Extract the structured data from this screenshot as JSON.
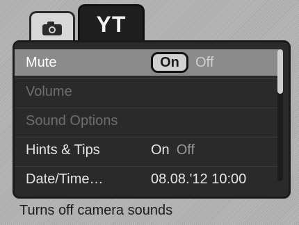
{
  "tabs": [
    {
      "icon": "camera-icon"
    },
    {
      "label": "YT"
    }
  ],
  "menu": {
    "rows": [
      {
        "label": "Mute",
        "value": "On",
        "alt": "Off",
        "selected": true
      },
      {
        "label": "Volume",
        "value": "",
        "alt": "",
        "disabled": true
      },
      {
        "label": "Sound Options",
        "value": "",
        "alt": "",
        "disabled": true
      },
      {
        "label": "Hints & Tips",
        "value": "On",
        "alt": "Off"
      },
      {
        "label": "Date/Time…",
        "value": "08.08.'12 10:00",
        "alt": ""
      }
    ]
  },
  "hint_text": "Turns off camera sounds",
  "colors": {
    "background": "#b7b7b7",
    "panel": "#2a2a2a",
    "selected_row": "#8b8b8b",
    "text": "#e6e6e6"
  }
}
